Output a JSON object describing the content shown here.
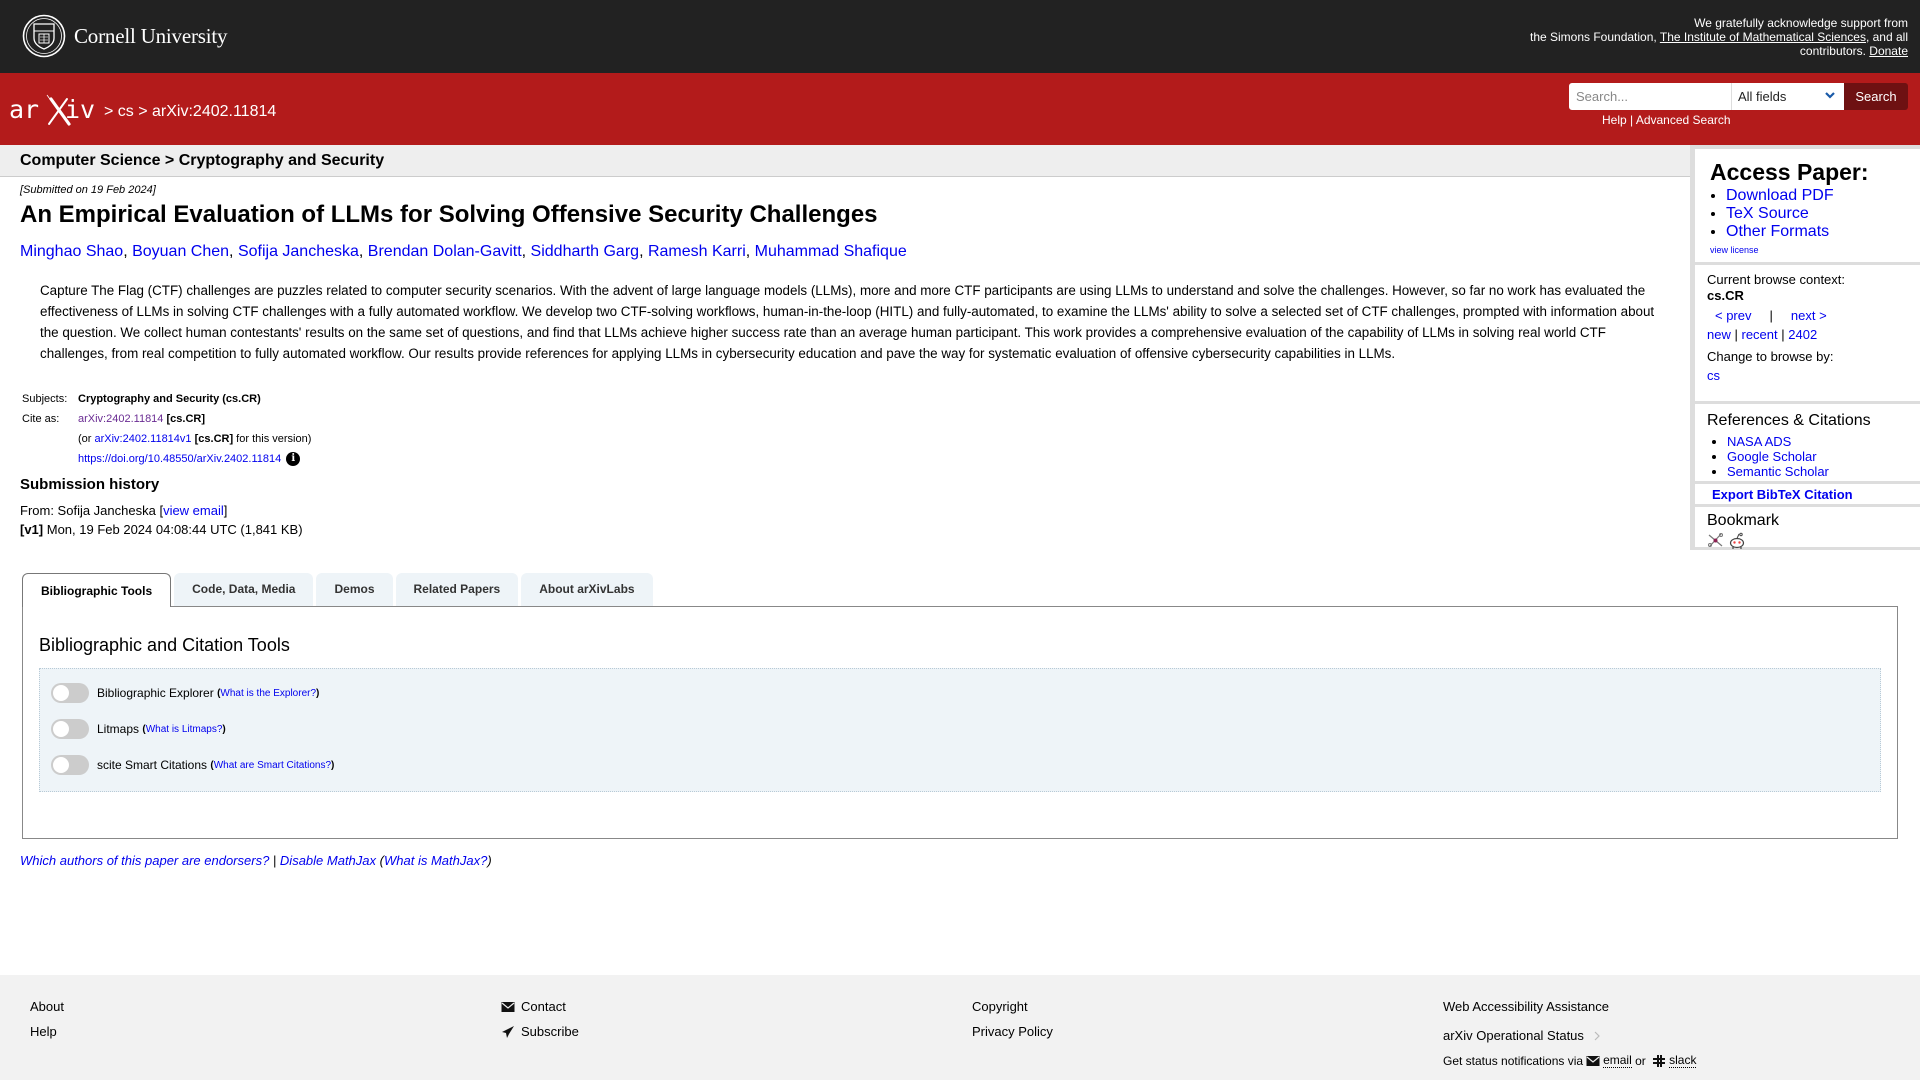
{
  "topbar": {
    "institution": "Cornell University",
    "support_line1": "We gratefully acknowledge support from",
    "support_line2_prefix": "the Simons Foundation, ",
    "support_link": "The Institute of Mathematical Sciences",
    "support_line2_suffix": ", and all",
    "support_line3_prefix": "contributors. ",
    "donate": "Donate"
  },
  "header": {
    "logo": "arXiv",
    "breadcrumb": "> cs > arXiv:2402.11814",
    "search": {
      "placeholder": "Search...",
      "field_selected": "All fields",
      "button": "Search",
      "help": "Help",
      "separator": "|",
      "advanced": "Advanced Search"
    }
  },
  "main": {
    "crumb": "Computer Science > Cryptography and Security",
    "submitted": "[Submitted on 19 Feb 2024]",
    "title": "An Empirical Evaluation of LLMs for Solving Offensive Security Challenges",
    "authors": [
      "Minghao Shao",
      "Boyuan Chen",
      "Sofija Jancheska",
      "Brendan Dolan-Gavitt",
      "Siddharth Garg",
      "Ramesh Karri",
      "Muhammad Shafique"
    ],
    "abstract": "Capture The Flag (CTF) challenges are puzzles related to computer security scenarios. With the advent of large language models (LLMs), more and more CTF participants are using LLMs to understand and solve the challenges. However, so far no work has evaluated the effectiveness of LLMs in solving CTF challenges with a fully automated workflow. We develop two CTF-solving workflows, human-in-the-loop (HITL) and fully-automated, to examine the LLMs' ability to solve a selected set of CTF challenges, prompted with information about the question. We collect human contestants' results on the same set of questions, and find that LLMs achieve higher success rate than an average human participant. This work provides a comprehensive evaluation of the capability of LLMs in solving real world CTF challenges, from real competition to fully automated workflow. Our results provide references for applying LLMs in cybersecurity education and pave the way for systematic evaluation of offensive cybersecurity capabilities in LLMs.",
    "meta": {
      "subjects_label": "Subjects:",
      "subjects_value": "Cryptography and Security (cs.CR)",
      "cite_label": "Cite as:",
      "cite_id": "arXiv:2402.11814",
      "cite_cat": "[cs.CR]",
      "version_prefix": "(or ",
      "version_id": "arXiv:2402.11814v1",
      "version_cat": "[cs.CR]",
      "version_suffix": " for this version)",
      "doi": "https://doi.org/10.48550/arXiv.2402.11814",
      "info_glyph": "i"
    },
    "submission_history": {
      "title": "Submission history",
      "from_prefix": "From: Sofija Jancheska [",
      "view_email": "view email",
      "from_suffix": "]",
      "v1_label": "[v1]",
      "v1_text": " Mon, 19 Feb 2024 04:08:44 UTC (1,841 KB)"
    }
  },
  "sidebar": {
    "access_title": "Access Paper:",
    "access_links": [
      "Download PDF",
      "TeX Source",
      "Other Formats"
    ],
    "view_license": "view license",
    "browse_context_label": "Current browse context:",
    "browse_context": "cs.CR",
    "prev": "< prev",
    "pipe": "|",
    "next": "next >",
    "new": "new",
    "recent": "recent",
    "month": "2402",
    "change_to_label": "Change to browse by:",
    "change_to": "cs",
    "refs_title": "References & Citations",
    "refs_links": [
      "NASA ADS",
      "Google Scholar",
      "Semantic Scholar"
    ],
    "export_bibtex": "Export BibTeX Citation",
    "bookmark_title": "Bookmark"
  },
  "tabs": {
    "items": [
      "Bibliographic Tools",
      "Code, Data, Media",
      "Demos",
      "Related Papers",
      "About arXivLabs"
    ],
    "active": 0,
    "panel_title": "Bibliographic and Citation Tools",
    "tools": [
      {
        "label": "Bibliographic Explorer",
        "help": "What is the Explorer?",
        "enabled": false
      },
      {
        "label": "Litmaps",
        "help": "What is Litmaps?",
        "enabled": false
      },
      {
        "label": "scite Smart Citations",
        "help": "What are Smart Citations?",
        "enabled": false
      }
    ]
  },
  "bottom_links": {
    "endorsers": "Which authors of this paper are endorsers?",
    "sep": " | ",
    "disable_mathjax": "Disable MathJax",
    "what_mathjax": "What is MathJax?"
  },
  "footer": {
    "col1": [
      "About",
      "Help"
    ],
    "col2": [
      "Contact",
      "Subscribe"
    ],
    "col3": [
      "Copyright",
      "Privacy Policy"
    ],
    "col4_a11y": "Web Accessibility Assistance",
    "col4_status": "arXiv Operational Status",
    "status_prefix": "Get status notifications via ",
    "status_email": "email",
    "status_or": " or ",
    "status_slack": "slack"
  },
  "colors": {
    "topbar": "#222222",
    "brand_red": "#b31b1b",
    "search_button": "#6e1112",
    "link": "#0000ee",
    "visited_link": "#6a2c93",
    "crumb_strip": "#eeeeee",
    "tools_bg": "#eef4f8",
    "footer_bg": "#f2f2f2"
  }
}
